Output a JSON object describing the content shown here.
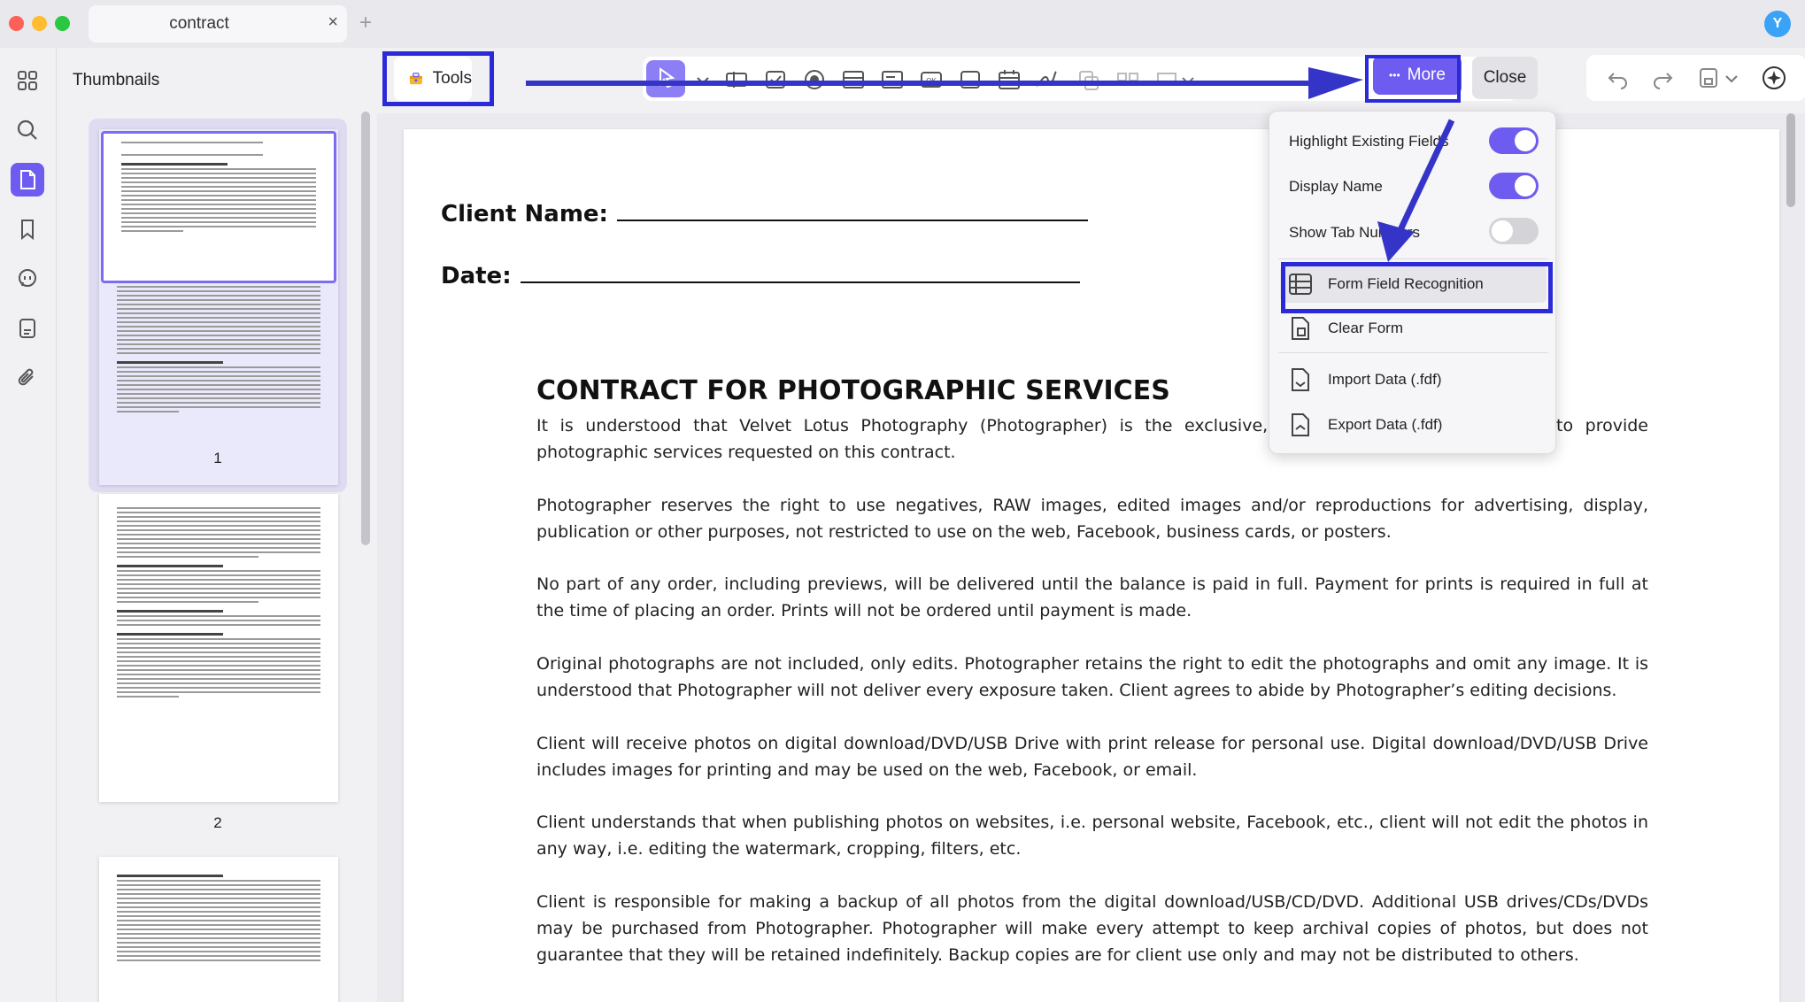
{
  "window": {
    "tab_title": "contract",
    "tab_close": "×",
    "tab_add": "+",
    "avatar_letter": "Y"
  },
  "sidebar": {
    "title": "Thumbnails",
    "pages": [
      "1",
      "2"
    ]
  },
  "toolbar": {
    "tools_label": "Tools",
    "more_label": "More",
    "more_dots": "•••",
    "close_label": "Close"
  },
  "dropdown": {
    "highlight_label": "Highlight Existing Fields",
    "highlight_on": true,
    "display_name_label": "Display Name",
    "display_name_on": true,
    "show_tab_label": "Show Tab Numbers",
    "show_tab_on": false,
    "form_field_recognition": "Form Field Recognition",
    "clear_form": "Clear Form",
    "import_data": "Import Data (.fdf)",
    "export_data": "Export Data (.fdf)"
  },
  "document": {
    "client_name_label": "Client Name:",
    "date_label": "Date:",
    "title": "CONTRACT FOR PHOTOGRAPHIC SERVICES",
    "paragraphs": [
      "It is understood that Velvet Lotus Photography (Photographer) is the exclusive, official photographer retained to provide photographic services requested on this contract.",
      "Photographer reserves the right to use negatives, RAW images, edited images and/or reproductions for advertising, display, publication or other purposes, not restricted to use on the web, Facebook, business cards, or posters.",
      "No part of any order, including previews, will be delivered until the balance is paid in full. Payment for prints is required in full at the time of placing an order. Prints will not be ordered until payment is made.",
      "Original photographs are not included, only edits. Photographer retains the right to edit the photographs and omit any image. It is understood that Photographer will not deliver every exposure taken. Client agrees to abide by Photographer’s editing decisions.",
      "Client will receive photos on digital download/DVD/USB Drive with print release for personal use. Digital download/DVD/USB Drive includes images for printing and may be used on the web, Facebook, or email.",
      "Client understands that when publishing photos on websites, i.e. personal website, Facebook, etc., client will not edit the photos in any way, i.e. editing the watermark, cropping, filters, etc.",
      "Client is responsible for making a backup of all photos from the digital download/USB/CD/DVD. Additional USB drives/CDs/DVDs may be purchased from Photographer. Photographer will make every attempt to keep archival copies of photos, but does not guarantee that they will be retained indefinitely. Backup copies are for client use only and may not be distributed to others."
    ]
  },
  "colors": {
    "accent": "#6e5cf0",
    "annotation": "#2a2ad8"
  }
}
